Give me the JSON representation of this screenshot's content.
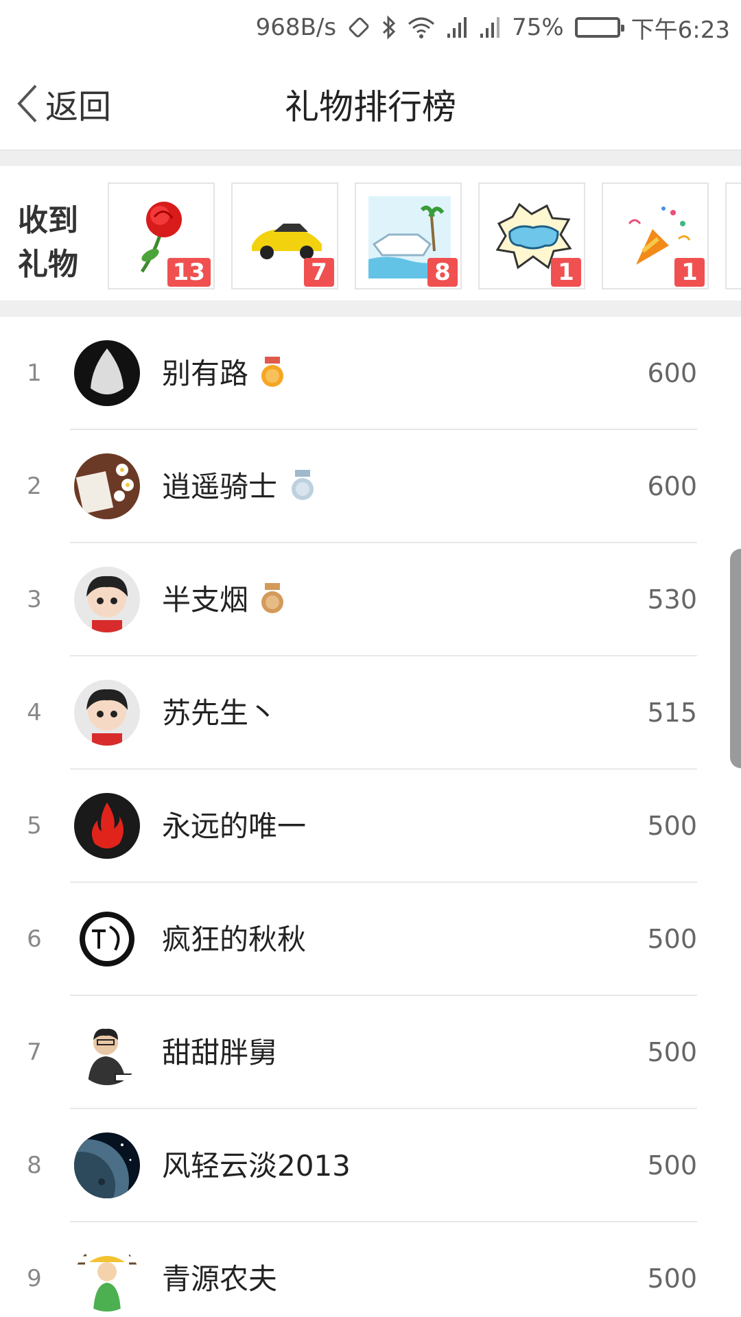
{
  "status_bar": {
    "speed": "968B/s",
    "battery": "75%",
    "battery_level": 0.75,
    "time": "下午6:23",
    "icons": [
      "rotate-icon",
      "bluetooth-icon",
      "wifi-icon",
      "signal-icon",
      "signal-icon",
      "battery-icon"
    ]
  },
  "nav": {
    "back_label": "返回",
    "title": "礼物排行榜"
  },
  "gifts": {
    "label": "收到礼物",
    "items": [
      {
        "icon": "rose-icon",
        "count": "13"
      },
      {
        "icon": "sports-car-icon",
        "count": "7"
      },
      {
        "icon": "yacht-icon",
        "count": "8"
      },
      {
        "icon": "cool-sticker-icon",
        "count": "1"
      },
      {
        "icon": "party-popper-icon",
        "count": "1"
      }
    ]
  },
  "ranking": [
    {
      "rank": "1",
      "name": "别有路",
      "score": "600",
      "medal": "gold"
    },
    {
      "rank": "2",
      "name": "逍遥骑士",
      "score": "600",
      "medal": "silver"
    },
    {
      "rank": "3",
      "name": "半支烟",
      "score": "530",
      "medal": "bronze"
    },
    {
      "rank": "4",
      "name": "苏先生丶",
      "score": "515"
    },
    {
      "rank": "5",
      "name": "永远的唯一",
      "score": "500"
    },
    {
      "rank": "6",
      "name": "疯狂的秋秋",
      "score": "500"
    },
    {
      "rank": "7",
      "name": "甜甜胖舅",
      "score": "500"
    },
    {
      "rank": "8",
      "name": "风轻云淡2013",
      "score": "500"
    },
    {
      "rank": "9",
      "name": "青源农夫",
      "score": "500"
    }
  ],
  "colors": {
    "accent": "#f05050",
    "gold": "#f5a623",
    "silver": "#9fb8cc",
    "bronze": "#d39a5a"
  }
}
